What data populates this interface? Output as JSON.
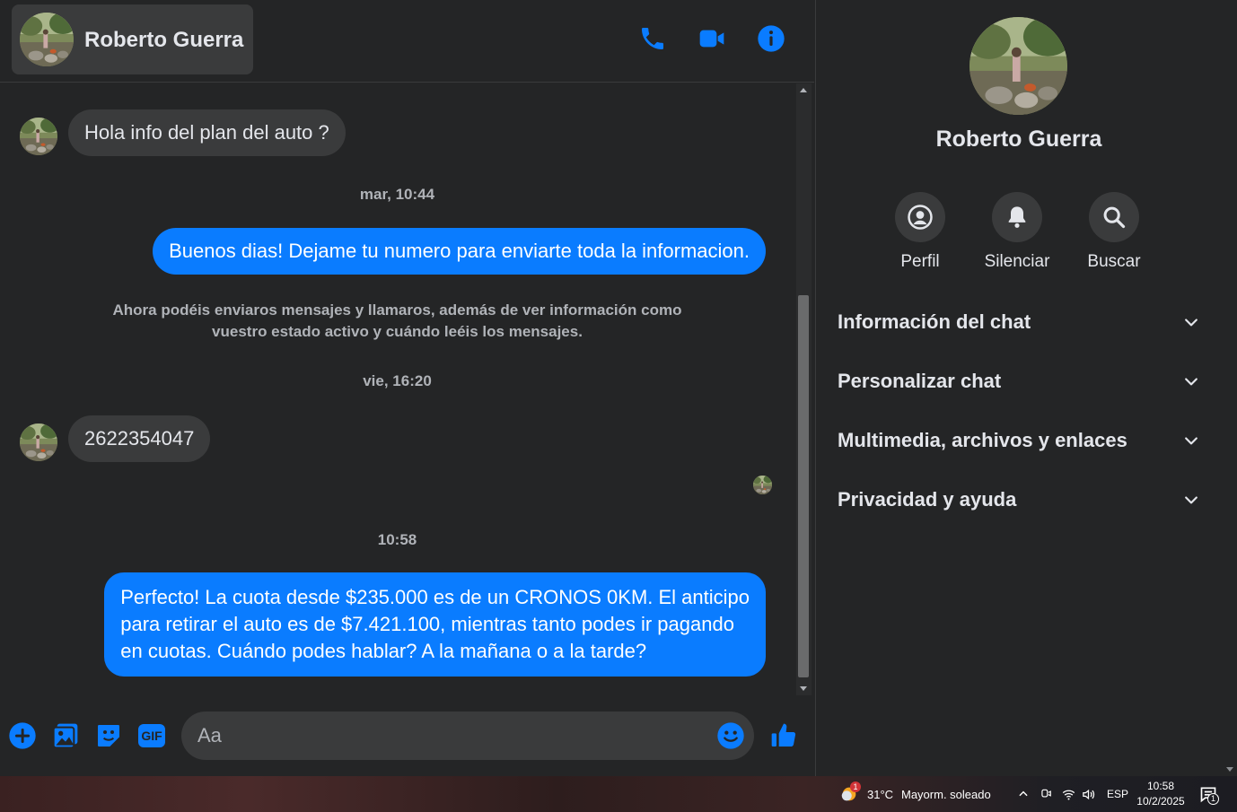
{
  "header": {
    "contact_name": "Roberto Guerra"
  },
  "messages": {
    "incoming_1": "Hola info del plan del auto ?",
    "stamp_1": "mar, 10:44",
    "outgoing_1": "Buenos dias! Dejame tu numero para enviarte toda la informacion.",
    "system_note_line1": "Ahora podéis enviaros mensajes y llamaros, además de ver información como",
    "system_note_line2": "vuestro estado activo y cuándo leéis los mensajes.",
    "stamp_2": "vie, 16:20",
    "incoming_2": "2622354047",
    "stamp_3": "10:58",
    "outgoing_2_line1": "Perfecto! La cuota desde $235.000 es de un CRONOS 0KM. El anticipo",
    "outgoing_2_line2": "para retirar el auto es de $7.421.100, mientras tanto podes ir pagando",
    "outgoing_2_line3": "en cuotas. Cuándo podes hablar? A la mañana o a la tarde?"
  },
  "composer": {
    "placeholder": "Aa",
    "gif_label": "GIF"
  },
  "info_panel": {
    "name": "Roberto Guerra",
    "actions": [
      {
        "label": "Perfil",
        "icon": "profile-icon"
      },
      {
        "label": "Silenciar",
        "icon": "bell-icon"
      },
      {
        "label": "Buscar",
        "icon": "search-icon"
      }
    ],
    "sections": [
      "Información del chat",
      "Personalizar chat",
      "Multimedia, archivos y enlaces",
      "Privacidad y ayuda"
    ]
  },
  "taskbar": {
    "weather_badge": "1",
    "temperature": "31°C",
    "weather_text": "Mayorm. soleado",
    "language": "ESP",
    "time": "10:58",
    "date": "10/2/2025",
    "notification_count": "1"
  },
  "colors": {
    "accent": "#0a7cff",
    "background": "#242526",
    "bubble_incoming": "#3a3b3c",
    "text_secondary": "#b0b3b8"
  }
}
